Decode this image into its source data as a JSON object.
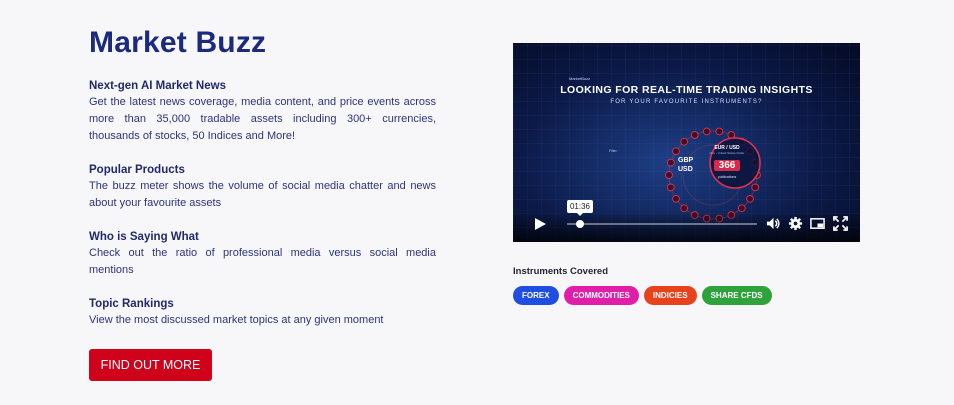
{
  "title": "Market Buzz",
  "sections": [
    {
      "heading": "Next-gen AI Market News",
      "body": "Get the latest news coverage, media content, and price events across more than 35,000 tradable assets including 300+ currencies, thousands of stocks, 50 Indices and More!"
    },
    {
      "heading": "Popular Products",
      "body": "The buzz meter shows the volume of social media chatter and news about your favourite assets"
    },
    {
      "heading": "Who is Saying What",
      "body": "Check out the ratio of professional media versus social media mentions"
    },
    {
      "heading": "Topic Rankings",
      "body": "View the most discussed market topics at any given moment"
    }
  ],
  "cta_label": "FIND OUT MORE",
  "video": {
    "brand": "MarketBuzz",
    "headline": "LOOKING FOR REAL-TIME TRADING INSIGHTS",
    "subheadline": "FOR YOUR FAVOURITE INSTRUMENTS?",
    "pair_left": "GBP",
    "pair_left_sub": "USD",
    "pair_label": "EUR / USD",
    "pair_small": "Nov - United States Dollar",
    "pair_count": "366",
    "pair_unit": "publications",
    "side_label": "Filter",
    "timestamp": "01:36",
    "progress": 0.07,
    "icons": [
      "play-icon",
      "volume-icon",
      "settings-gear-icon",
      "picture-in-picture-icon",
      "fullscreen-icon"
    ]
  },
  "instruments_label": "Instruments Covered",
  "tags": [
    {
      "label": "FOREX",
      "color": "#1f4fe0"
    },
    {
      "label": "COMMODITIES",
      "color": "#e01eaa"
    },
    {
      "label": "INDICIES",
      "color": "#e8421c"
    },
    {
      "label": "SHARE CFDS",
      "color": "#2ea33c"
    }
  ]
}
